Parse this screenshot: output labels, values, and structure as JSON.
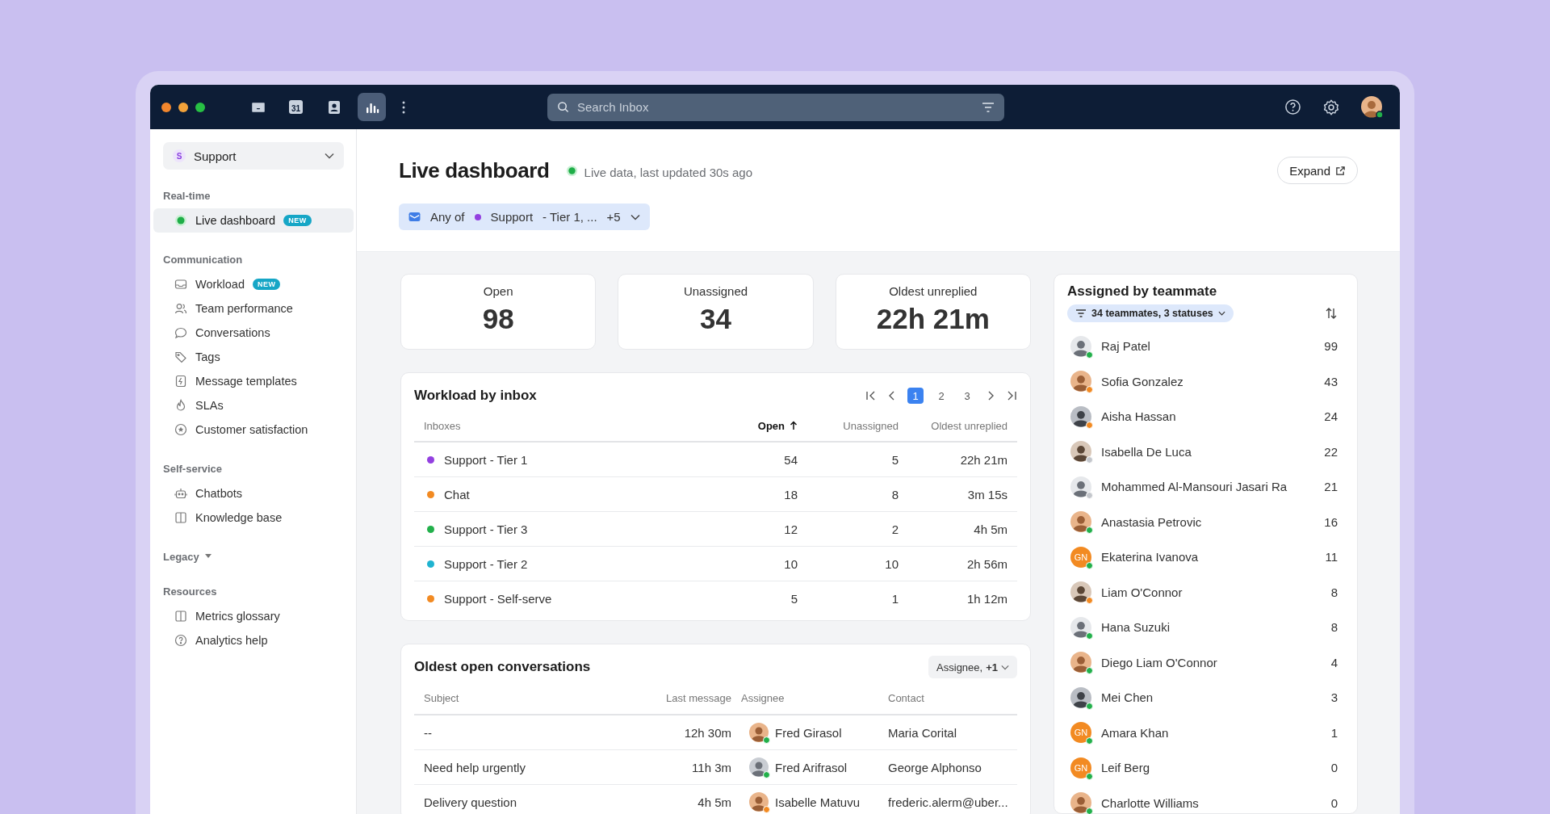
{
  "topbar": {
    "apps": [
      {
        "selected": false
      },
      {
        "selected": false,
        "day": "31"
      },
      {
        "selected": false
      },
      {
        "selected": true
      }
    ],
    "search": {
      "placeholder": "Search Inbox"
    }
  },
  "sidebar": {
    "workspace": {
      "badge": "S",
      "label": "Support"
    },
    "sections": [
      {
        "title": "Real-time",
        "expanded": true,
        "items": [
          {
            "label": "Live dashboard",
            "badge": "NEW",
            "selected": true
          }
        ]
      },
      {
        "title": "Communication",
        "expanded": true,
        "items": [
          {
            "label": "Workload",
            "badge": "NEW",
            "selected": false
          },
          {
            "label": "Team performance",
            "selected": false
          },
          {
            "label": "Conversations",
            "selected": false
          },
          {
            "label": "Tags",
            "selected": false
          },
          {
            "label": "Message templates",
            "selected": false
          },
          {
            "label": "SLAs",
            "selected": false
          },
          {
            "label": "Customer satisfaction",
            "selected": false
          }
        ]
      },
      {
        "title": "Self-service",
        "expanded": true,
        "items": [
          {
            "label": "Chatbots",
            "selected": false
          },
          {
            "label": "Knowledge base",
            "selected": false
          }
        ]
      },
      {
        "title": "Legacy",
        "expanded": false
      },
      {
        "title": "Resources",
        "expanded": true,
        "items": [
          {
            "label": "Metrics glossary",
            "selected": false
          },
          {
            "label": "Analytics help",
            "selected": false
          }
        ]
      }
    ]
  },
  "header": {
    "title": "Live dashboard",
    "status": "Live data, last updated 30s ago",
    "expand": "Expand",
    "filter": {
      "prefix": "Any of",
      "value": "Support",
      "suffix": "- Tier 1, ...",
      "more": "+5"
    }
  },
  "stats": [
    {
      "label": "Open",
      "value": "98"
    },
    {
      "label": "Unassigned",
      "value": "34"
    },
    {
      "label": "Oldest unreplied",
      "value": "22h 21m"
    }
  ],
  "workload": {
    "title": "Workload by inbox",
    "pages": [
      {
        "label": "1",
        "selected": true
      },
      {
        "label": "2",
        "selected": false
      },
      {
        "label": "3",
        "selected": false
      }
    ],
    "columns": [
      {
        "label": "Inboxes",
        "sorted": false
      },
      {
        "label": "Open",
        "sorted": true
      },
      {
        "label": "Unassigned",
        "sorted": false
      },
      {
        "label": "Oldest unreplied",
        "sorted": false
      }
    ],
    "rows": [
      {
        "name": "Support - Tier 1",
        "color": "#9340e0",
        "open": "54",
        "unassigned": "5",
        "oldest": "22h 21m"
      },
      {
        "name": "Chat",
        "color": "#f28a22",
        "open": "18",
        "unassigned": "8",
        "oldest": "3m 15s"
      },
      {
        "name": "Support - Tier 3",
        "color": "#22b04b",
        "open": "12",
        "unassigned": "2",
        "oldest": "4h 5m"
      },
      {
        "name": "Support - Tier 2",
        "color": "#1fb3d0",
        "open": "10",
        "unassigned": "10",
        "oldest": "2h 56m"
      },
      {
        "name": "Support - Self-serve",
        "color": "#f28a22",
        "open": "5",
        "unassigned": "1",
        "oldest": "1h 12m"
      }
    ]
  },
  "oldest": {
    "title": "Oldest open conversations",
    "filter": {
      "label": "Assignee,",
      "more": "+1"
    },
    "columns": [
      "Subject",
      "Last message",
      "Assignee",
      "Contact"
    ],
    "rows": [
      {
        "subject": "--",
        "last": "12h 30m",
        "assignee": "Fred Girasol",
        "color": "#22b04b",
        "contact": "Maria Corital"
      },
      {
        "subject": "Need help urgently",
        "last": "11h 3m",
        "assignee": "Fred Arifrasol",
        "color": "#22b04b",
        "contact": "George Alphonso"
      },
      {
        "subject": "Delivery question",
        "last": "4h 5m",
        "assignee": "Isabelle Matuvu",
        "color": "#f28a22",
        "contact": "frederic.alerm@uber..."
      }
    ]
  },
  "teammates": {
    "title": "Assigned by teammate",
    "filter": "34 teammates, 3 statuses",
    "members": [
      {
        "kind": "photo",
        "name": "Raj Patel",
        "count": "99",
        "color": "#22b04b"
      },
      {
        "kind": "photo",
        "name": "Sofia Gonzalez",
        "count": "43",
        "color": "#f28a22"
      },
      {
        "kind": "photo",
        "name": "Aisha Hassan",
        "count": "24",
        "color": "#f28a22"
      },
      {
        "kind": "photo",
        "name": "Isabella De Luca",
        "count": "22",
        "color": "#c4c7cc"
      },
      {
        "kind": "photo",
        "name": "Mohammed Al-Mansouri Jasari Ra",
        "count": "21",
        "color": "#c4c7cc"
      },
      {
        "kind": "photo",
        "name": "Anastasia Petrovic",
        "count": "16",
        "color": "#22b04b"
      },
      {
        "kind": "initials",
        "initials": "GN",
        "name": "Ekaterina Ivanova",
        "count": "11",
        "color": "#22b04b"
      },
      {
        "kind": "photo",
        "name": "Liam O'Connor",
        "count": "8",
        "color": "#f28a22"
      },
      {
        "kind": "photo",
        "name": "Hana Suzuki",
        "count": "8",
        "color": "#22b04b"
      },
      {
        "kind": "photo",
        "name": "Diego Liam O'Connor",
        "count": "4",
        "color": "#22b04b"
      },
      {
        "kind": "photo",
        "name": "Mei Chen",
        "count": "3",
        "color": "#22b04b"
      },
      {
        "kind": "initials",
        "initials": "GN",
        "name": "Amara Khan",
        "count": "1",
        "color": "#22b04b"
      },
      {
        "kind": "initials",
        "initials": "GN",
        "name": "Leif Berg",
        "count": "0",
        "color": "#22b04b"
      },
      {
        "kind": "photo",
        "name": "Charlotte Williams",
        "count": "0",
        "color": "#22b04b"
      }
    ]
  }
}
